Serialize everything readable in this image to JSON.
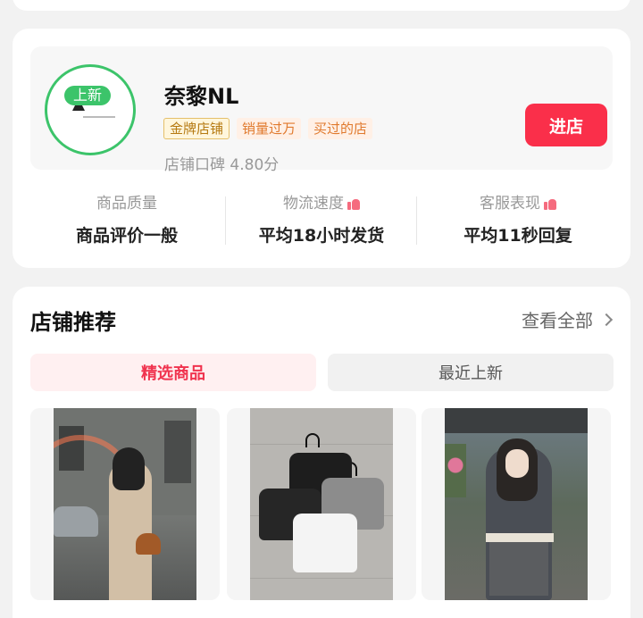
{
  "store": {
    "avatar_badge": "上新",
    "name": "奈黎NL",
    "tags": [
      "金牌店铺",
      "销量过万",
      "买过的店"
    ],
    "rating_label": "店铺口碑",
    "rating_value": "4.80分",
    "enter_button": "进店",
    "metrics": [
      {
        "label": "商品质量",
        "value": "商品评价一般",
        "thumb": false
      },
      {
        "label": "物流速度",
        "value": "平均18小时发货",
        "thumb": true
      },
      {
        "label": "客服表现",
        "value": "平均11秒回复",
        "thumb": true
      }
    ]
  },
  "recommend": {
    "title": "店铺推荐",
    "see_all": "查看全部",
    "tabs": [
      {
        "label": "精选商品",
        "active": true
      },
      {
        "label": "最近上新",
        "active": false
      }
    ],
    "products": [
      {
        "icon": "photo-woman-street"
      },
      {
        "icon": "photo-tshirts"
      },
      {
        "icon": "photo-woman-cafe"
      }
    ]
  },
  "colors": {
    "accent": "#fa2f4a",
    "new_badge": "#3cc46a",
    "gold_tag": "#b57a12"
  }
}
